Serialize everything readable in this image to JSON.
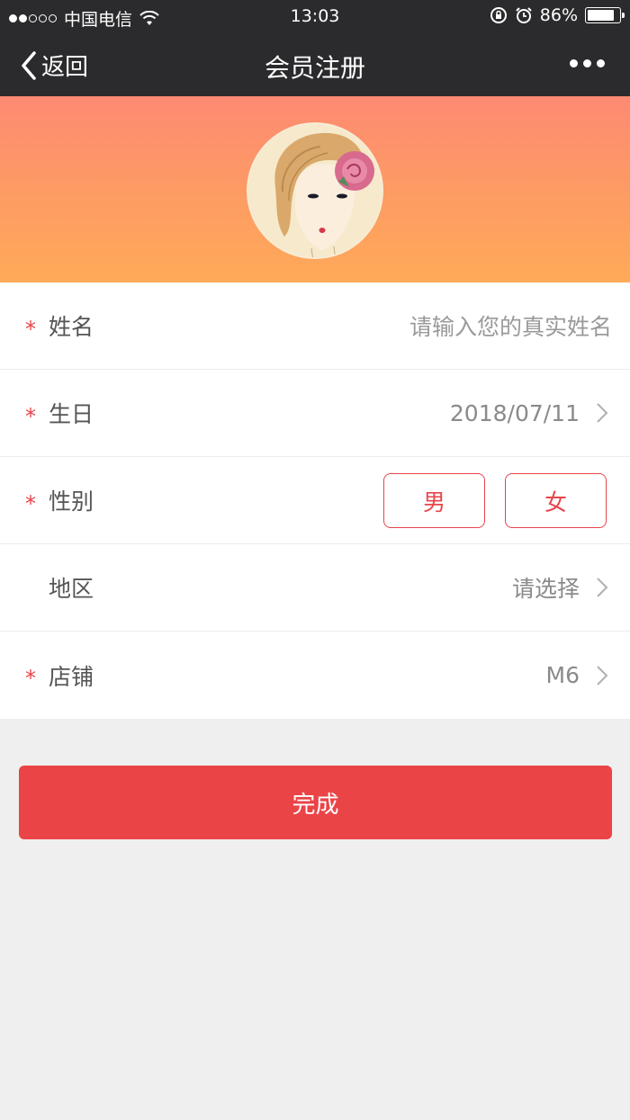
{
  "status_bar": {
    "carrier": "中国电信",
    "time": "13:03",
    "battery": "86%",
    "battery_level": 0.86
  },
  "nav": {
    "back_label": "返回",
    "title": "会员注册"
  },
  "form": {
    "name": {
      "label": "姓名",
      "placeholder": "请输入您的真实姓名",
      "required": true
    },
    "birthday": {
      "label": "生日",
      "value": "2018/07/11",
      "required": true
    },
    "gender": {
      "label": "性别",
      "options": [
        "男",
        "女"
      ],
      "required": true
    },
    "region": {
      "label": "地区",
      "value": "请选择",
      "required": false
    },
    "store": {
      "label": "店铺",
      "value": "M6",
      "required": true
    },
    "required_mark": "*"
  },
  "submit_label": "完成",
  "colors": {
    "accent": "#ea4447",
    "header_bg": "#2b2b2d",
    "banner_top": "#fd8a72",
    "banner_bottom": "#ffaa58",
    "page_bg": "#efefef"
  },
  "icons": [
    "wifi-icon",
    "orientation-lock-icon",
    "alarm-icon",
    "battery-icon",
    "back-chevron-icon",
    "more-icon",
    "chevron-right-icon"
  ]
}
